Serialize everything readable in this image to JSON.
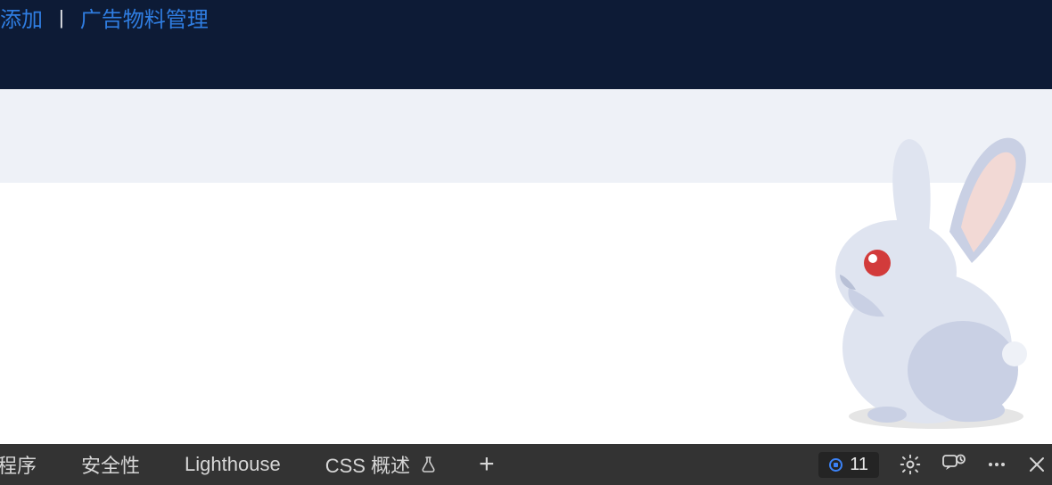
{
  "top_nav": {
    "items": [
      {
        "label": "添加"
      },
      {
        "label": "广告物料管理"
      }
    ],
    "separator": "|"
  },
  "rabbit": {
    "name": "rabbit-illustration"
  },
  "devtools": {
    "tabs": [
      {
        "label": "程序"
      },
      {
        "label": "安全性"
      },
      {
        "label": "Lighthouse"
      },
      {
        "label": "CSS 概述"
      }
    ],
    "issues_count": "11"
  }
}
